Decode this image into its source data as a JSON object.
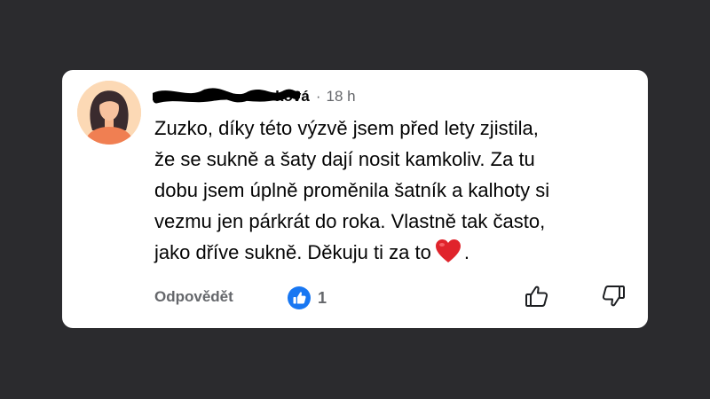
{
  "comment": {
    "author_visible_suffix": "ková",
    "separator": "·",
    "time": "18 h",
    "lines": [
      "Zuzko, díky této výzvě jsem před lety zjistila,",
      "že se sukně a šaty dají nosit kamkoliv. Za tu",
      "dobu jsem úplně proměnila šatník a kalhoty si",
      "vezmu jen párkrát do roka. Vlastně tak často,",
      "jako dříve sukně. Děkuju ti za to"
    ],
    "last_line_suffix": ".",
    "emoji": "heart-emoji"
  },
  "actions": {
    "reply_label": "Odpovědět",
    "like_count": "1",
    "like_icon": "like-badge-icon",
    "upvote_icon": "thumbs-up-icon",
    "downvote_icon": "thumbs-down-icon"
  },
  "colors": {
    "background": "#2b2b2e",
    "card": "#ffffff",
    "text": "#050505",
    "muted": "#65676b",
    "like_blue": "#1877f2",
    "heart_red": "#e0242c",
    "avatar_bg": "#fcd9b5"
  }
}
